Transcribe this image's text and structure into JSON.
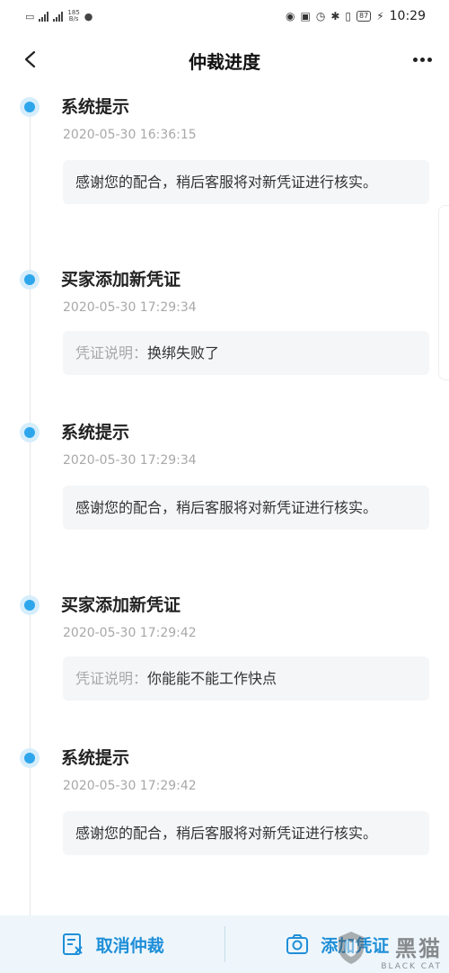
{
  "status_bar": {
    "net_speed_value": "185",
    "net_speed_unit": "B/s",
    "battery": "87",
    "time": "10:29"
  },
  "nav": {
    "title": "仲裁进度"
  },
  "timeline": [
    {
      "title": "系统提示",
      "time": "2020-05-30 16:36:15",
      "label": "",
      "text": "感谢您的配合，稍后客服将对新凭证进行核实。"
    },
    {
      "title": "买家添加新凭证",
      "time": "2020-05-30 17:29:34",
      "label": "凭证说明：",
      "text": "换绑失败了"
    },
    {
      "title": "系统提示",
      "time": "2020-05-30 17:29:34",
      "label": "",
      "text": "感谢您的配合，稍后客服将对新凭证进行核实。"
    },
    {
      "title": "买家添加新凭证",
      "time": "2020-05-30 17:29:42",
      "label": "凭证说明：",
      "text": "你能能不能工作快点"
    },
    {
      "title": "系统提示",
      "time": "2020-05-30 17:29:42",
      "label": "",
      "text": "感谢您的配合，稍后客服将对新凭证进行核实。"
    }
  ],
  "bottom_bar": {
    "cancel_label": "取消仲裁",
    "add_label": "添加凭证"
  },
  "watermark": {
    "cn": "黑猫",
    "en": "BLACK CAT"
  },
  "icons": {
    "back": "chevron-left-icon",
    "more": "more-dots-icon",
    "cancel": "document-cancel-icon",
    "add": "camera-icon"
  },
  "colors": {
    "accent": "#2ea6ec",
    "button_text": "#1f8fd8",
    "bottom_bar_bg": "#eef6fc",
    "message_bg": "#f5f6f8"
  }
}
